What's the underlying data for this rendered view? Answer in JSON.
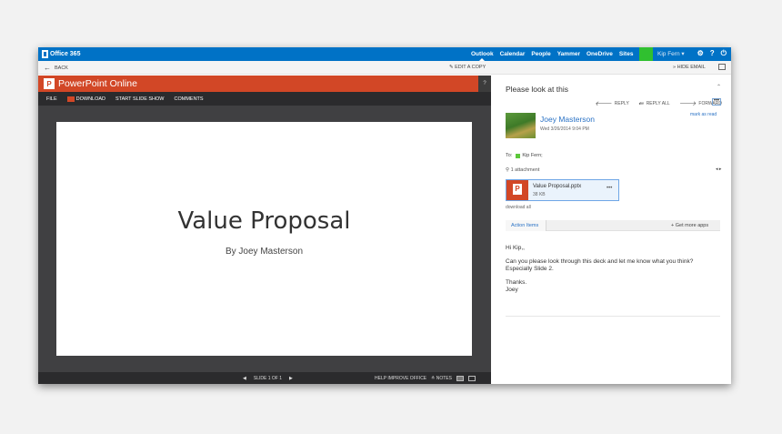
{
  "suite_bar": {
    "brand": "Office 365",
    "nav": [
      "Outlook",
      "Calendar",
      "People",
      "Yammer",
      "OneDrive",
      "Sites",
      "•••"
    ],
    "user": "Kip Fern ▾",
    "icons": [
      "gear-icon",
      "help-icon",
      "power-icon"
    ],
    "gear": "⚙",
    "help": "?",
    "power": "⏻"
  },
  "command_bar": {
    "back": "BACK",
    "edit_copy": "EDIT A COPY",
    "hide_email": "HIDE EMAIL"
  },
  "ppt": {
    "app_title": "PowerPoint Online",
    "help": "?",
    "menu": {
      "file": "FILE",
      "download": "DOWNLOAD",
      "slideshow": "START SLIDE SHOW",
      "comments": "COMMENTS"
    },
    "slide": {
      "title": "Value Proposal",
      "subtitle": "By Joey Masterson"
    },
    "status": {
      "slide_counter": "SLIDE 1 OF 1",
      "help_improve": "HELP IMPROVE OFFICE",
      "notes": "NOTES"
    }
  },
  "email": {
    "subject": "Please look at this",
    "actions": {
      "reply": "REPLY",
      "reply_all": "REPLY ALL",
      "forward": "FORWARD",
      "more": "•••"
    },
    "sender": "Joey Masterson",
    "sent": "Wed 3/26/2014 9:04 PM",
    "mark_read": "mark as read",
    "to_label": "To:",
    "to_name": "Kip Fern;",
    "attachment_count": "1 attachment",
    "attachment": {
      "name": "Value Proposal.pptx",
      "size": "38 KB",
      "more": "•••"
    },
    "download_all": "download all",
    "apps": {
      "tab": "Action Items",
      "get_more": "+ Get more apps"
    },
    "body": [
      "Hi Kip,,",
      "Can you please look through this deck and let me know what you think? Especially Slide 2.",
      "Thanks.\nJoey"
    ]
  },
  "colors": {
    "suite_blue": "#0072c6",
    "ppt_orange": "#d24726",
    "link_blue": "#2a72c5",
    "presence_green": "#5cc83a"
  }
}
